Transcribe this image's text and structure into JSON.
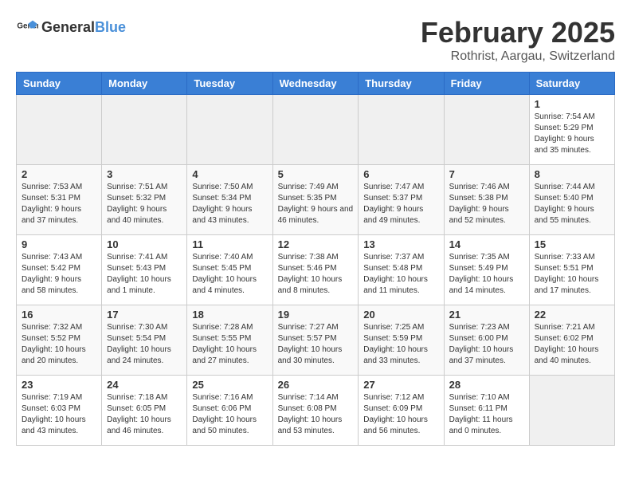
{
  "header": {
    "logo_general": "General",
    "logo_blue": "Blue",
    "month_year": "February 2025",
    "location": "Rothrist, Aargau, Switzerland"
  },
  "weekdays": [
    "Sunday",
    "Monday",
    "Tuesday",
    "Wednesday",
    "Thursday",
    "Friday",
    "Saturday"
  ],
  "weeks": [
    [
      {
        "day": "",
        "info": ""
      },
      {
        "day": "",
        "info": ""
      },
      {
        "day": "",
        "info": ""
      },
      {
        "day": "",
        "info": ""
      },
      {
        "day": "",
        "info": ""
      },
      {
        "day": "",
        "info": ""
      },
      {
        "day": "1",
        "info": "Sunrise: 7:54 AM\nSunset: 5:29 PM\nDaylight: 9 hours and 35 minutes."
      }
    ],
    [
      {
        "day": "2",
        "info": "Sunrise: 7:53 AM\nSunset: 5:31 PM\nDaylight: 9 hours and 37 minutes."
      },
      {
        "day": "3",
        "info": "Sunrise: 7:51 AM\nSunset: 5:32 PM\nDaylight: 9 hours and 40 minutes."
      },
      {
        "day": "4",
        "info": "Sunrise: 7:50 AM\nSunset: 5:34 PM\nDaylight: 9 hours and 43 minutes."
      },
      {
        "day": "5",
        "info": "Sunrise: 7:49 AM\nSunset: 5:35 PM\nDaylight: 9 hours and 46 minutes."
      },
      {
        "day": "6",
        "info": "Sunrise: 7:47 AM\nSunset: 5:37 PM\nDaylight: 9 hours and 49 minutes."
      },
      {
        "day": "7",
        "info": "Sunrise: 7:46 AM\nSunset: 5:38 PM\nDaylight: 9 hours and 52 minutes."
      },
      {
        "day": "8",
        "info": "Sunrise: 7:44 AM\nSunset: 5:40 PM\nDaylight: 9 hours and 55 minutes."
      }
    ],
    [
      {
        "day": "9",
        "info": "Sunrise: 7:43 AM\nSunset: 5:42 PM\nDaylight: 9 hours and 58 minutes."
      },
      {
        "day": "10",
        "info": "Sunrise: 7:41 AM\nSunset: 5:43 PM\nDaylight: 10 hours and 1 minute."
      },
      {
        "day": "11",
        "info": "Sunrise: 7:40 AM\nSunset: 5:45 PM\nDaylight: 10 hours and 4 minutes."
      },
      {
        "day": "12",
        "info": "Sunrise: 7:38 AM\nSunset: 5:46 PM\nDaylight: 10 hours and 8 minutes."
      },
      {
        "day": "13",
        "info": "Sunrise: 7:37 AM\nSunset: 5:48 PM\nDaylight: 10 hours and 11 minutes."
      },
      {
        "day": "14",
        "info": "Sunrise: 7:35 AM\nSunset: 5:49 PM\nDaylight: 10 hours and 14 minutes."
      },
      {
        "day": "15",
        "info": "Sunrise: 7:33 AM\nSunset: 5:51 PM\nDaylight: 10 hours and 17 minutes."
      }
    ],
    [
      {
        "day": "16",
        "info": "Sunrise: 7:32 AM\nSunset: 5:52 PM\nDaylight: 10 hours and 20 minutes."
      },
      {
        "day": "17",
        "info": "Sunrise: 7:30 AM\nSunset: 5:54 PM\nDaylight: 10 hours and 24 minutes."
      },
      {
        "day": "18",
        "info": "Sunrise: 7:28 AM\nSunset: 5:55 PM\nDaylight: 10 hours and 27 minutes."
      },
      {
        "day": "19",
        "info": "Sunrise: 7:27 AM\nSunset: 5:57 PM\nDaylight: 10 hours and 30 minutes."
      },
      {
        "day": "20",
        "info": "Sunrise: 7:25 AM\nSunset: 5:59 PM\nDaylight: 10 hours and 33 minutes."
      },
      {
        "day": "21",
        "info": "Sunrise: 7:23 AM\nSunset: 6:00 PM\nDaylight: 10 hours and 37 minutes."
      },
      {
        "day": "22",
        "info": "Sunrise: 7:21 AM\nSunset: 6:02 PM\nDaylight: 10 hours and 40 minutes."
      }
    ],
    [
      {
        "day": "23",
        "info": "Sunrise: 7:19 AM\nSunset: 6:03 PM\nDaylight: 10 hours and 43 minutes."
      },
      {
        "day": "24",
        "info": "Sunrise: 7:18 AM\nSunset: 6:05 PM\nDaylight: 10 hours and 46 minutes."
      },
      {
        "day": "25",
        "info": "Sunrise: 7:16 AM\nSunset: 6:06 PM\nDaylight: 10 hours and 50 minutes."
      },
      {
        "day": "26",
        "info": "Sunrise: 7:14 AM\nSunset: 6:08 PM\nDaylight: 10 hours and 53 minutes."
      },
      {
        "day": "27",
        "info": "Sunrise: 7:12 AM\nSunset: 6:09 PM\nDaylight: 10 hours and 56 minutes."
      },
      {
        "day": "28",
        "info": "Sunrise: 7:10 AM\nSunset: 6:11 PM\nDaylight: 11 hours and 0 minutes."
      },
      {
        "day": "",
        "info": ""
      }
    ]
  ]
}
